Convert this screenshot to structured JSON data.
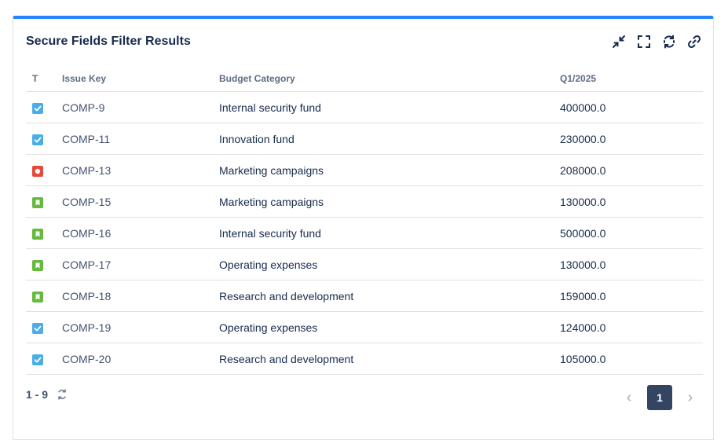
{
  "gadget": {
    "title": "Secure Fields Filter Results",
    "accent_color": "#2684ff",
    "actions": [
      "minimize-icon",
      "fullscreen-icon",
      "refresh-icon",
      "link-icon"
    ]
  },
  "table": {
    "headers": {
      "type": "T",
      "key": "Issue Key",
      "category": "Budget Category",
      "q1": "Q1/2025"
    },
    "rows": [
      {
        "type": "task",
        "key": "COMP-9",
        "category": "Internal security fund",
        "q1": "400000.0"
      },
      {
        "type": "task",
        "key": "COMP-11",
        "category": "Innovation fund",
        "q1": "230000.0"
      },
      {
        "type": "bug",
        "key": "COMP-13",
        "category": "Marketing campaigns",
        "q1": "208000.0"
      },
      {
        "type": "story",
        "key": "COMP-15",
        "category": "Marketing campaigns",
        "q1": "130000.0"
      },
      {
        "type": "story",
        "key": "COMP-16",
        "category": "Internal security fund",
        "q1": "500000.0"
      },
      {
        "type": "story",
        "key": "COMP-17",
        "category": "Operating expenses",
        "q1": "130000.0"
      },
      {
        "type": "story",
        "key": "COMP-18",
        "category": "Research and development",
        "q1": "159000.0"
      },
      {
        "type": "task",
        "key": "COMP-19",
        "category": "Operating expenses",
        "q1": "124000.0"
      },
      {
        "type": "task",
        "key": "COMP-20",
        "category": "Research and development",
        "q1": "105000.0"
      }
    ],
    "type_colors": {
      "task": "#4bade8",
      "bug": "#e5493a",
      "story": "#63ba3c"
    }
  },
  "footer": {
    "count": "1 - 9",
    "current_page": "1",
    "prev_icon": "chevron-left-icon",
    "next_icon": "chevron-right-icon"
  }
}
